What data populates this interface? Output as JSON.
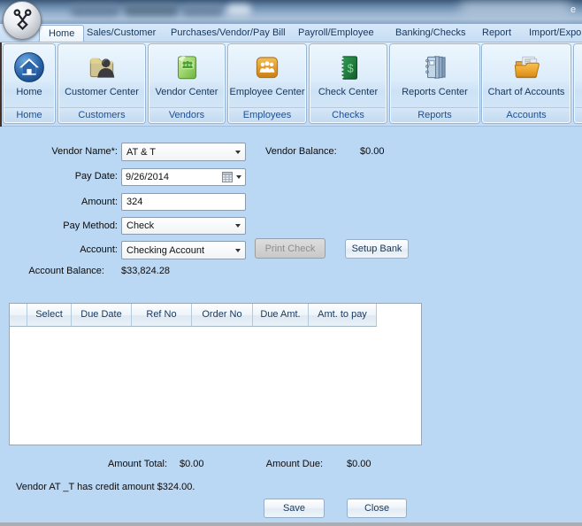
{
  "titlebar": {
    "overflow_letter": "e"
  },
  "tabs": [
    {
      "label": "Home"
    },
    {
      "label": "Sales/Customer"
    },
    {
      "label": "Purchases/Vendor/Pay Bill"
    },
    {
      "label": "Payroll/Employee"
    },
    {
      "label": "Banking/Checks"
    },
    {
      "label": "Report"
    },
    {
      "label": "Import/Export"
    }
  ],
  "ribbon": {
    "groups": [
      {
        "button": "Home",
        "group": "Home",
        "icon": "home-icon"
      },
      {
        "button": "Customer Center",
        "group": "Customers",
        "icon": "customer-center-icon"
      },
      {
        "button": "Vendor Center",
        "group": "Vendors",
        "icon": "vendor-center-icon"
      },
      {
        "button": "Employee Center",
        "group": "Employees",
        "icon": "employee-center-icon"
      },
      {
        "button": "Check Center",
        "group": "Checks",
        "icon": "check-center-icon"
      },
      {
        "button": "Reports Center",
        "group": "Reports",
        "icon": "reports-center-icon"
      },
      {
        "button": "Chart of Accounts",
        "group": "Accounts",
        "icon": "chart-of-accounts-icon"
      }
    ]
  },
  "form": {
    "vendor_name": {
      "label": "Vendor Name*:",
      "value": "AT & T"
    },
    "vendor_balance": {
      "label": "Vendor Balance:",
      "value": "$0.00"
    },
    "pay_date": {
      "label": "Pay Date:",
      "value": "9/26/2014"
    },
    "amount": {
      "label": "Amount:",
      "value": "324"
    },
    "pay_method": {
      "label": "Pay Method:",
      "value": "Check"
    },
    "account": {
      "label": "Account:",
      "value": "Checking Account"
    },
    "account_balance": {
      "label": "Account Balance:",
      "value": "$33,824.28"
    },
    "print_check_label": "Print Check",
    "setup_bank_label": "Setup Bank"
  },
  "grid": {
    "headers": [
      "Select",
      "Due Date",
      "Ref No",
      "Order No",
      "Due Amt.",
      "Amt. to pay"
    ],
    "rows": []
  },
  "totals": {
    "amount_total_label": "Amount Total:",
    "amount_total_value": "$0.00",
    "amount_due_label": "Amount Due:",
    "amount_due_value": "$0.00"
  },
  "message": "Vendor AT _T has credit amount $324.00.",
  "buttons": {
    "save": "Save",
    "close": "Close"
  },
  "colors": {
    "form_bg": "#bad7f4",
    "accent_navy": "#16365c",
    "disabled_gray": "#d2d2d2",
    "titlebar_blue": "#6d8cad"
  }
}
